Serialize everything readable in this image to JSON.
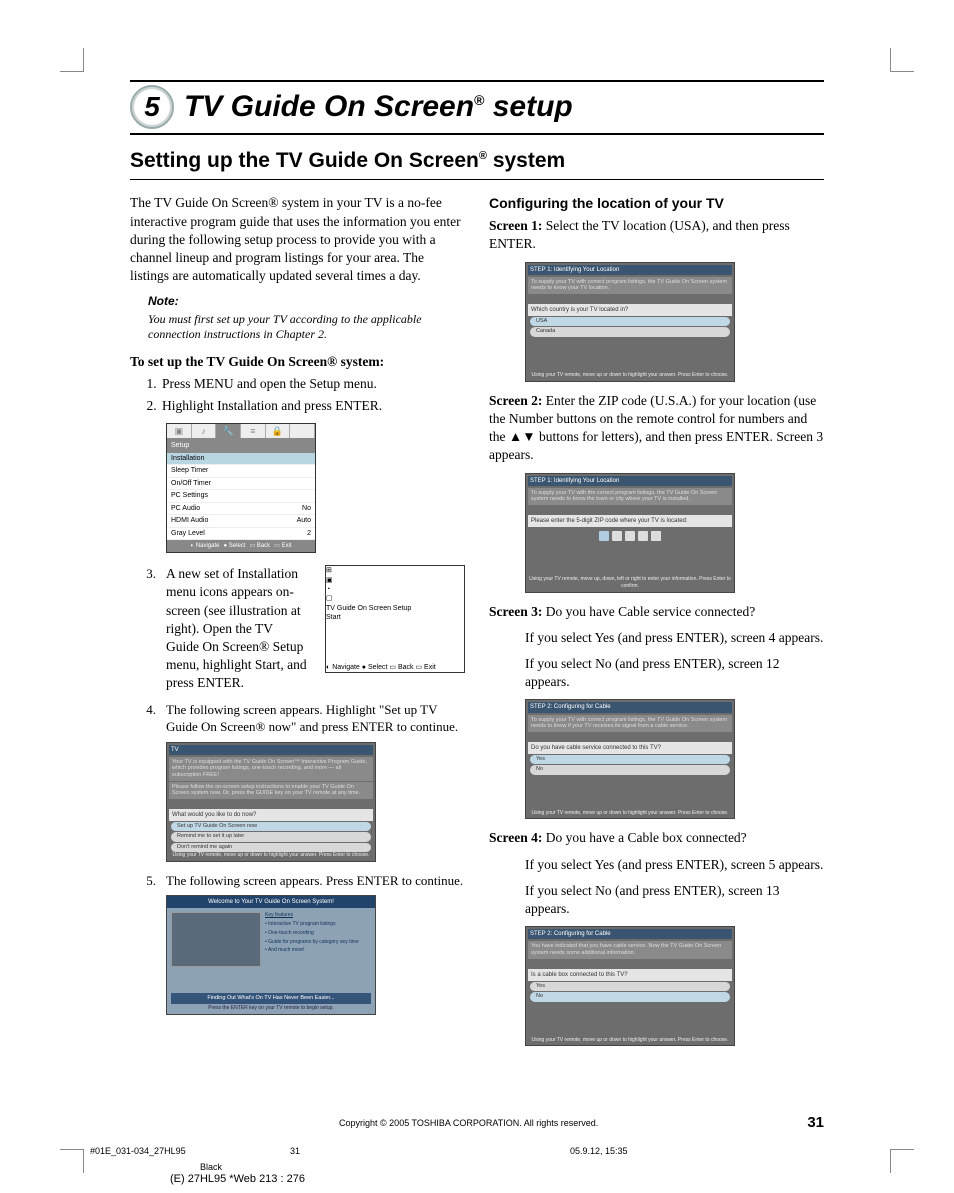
{
  "chapter": {
    "number": "5",
    "title_pre": "TV Guide On Screen",
    "title_post": " setup"
  },
  "section": {
    "title_pre": "Setting up the TV Guide On Screen",
    "title_post": " system"
  },
  "col1": {
    "intro": "The TV Guide On Screen® system in your TV is a no-fee interactive program guide that uses the information you enter during the following setup process to provide you with a channel lineup and program listings for your area. The listings are automatically updated several times a day.",
    "note_label": "Note:",
    "note_body": "You must first set up your TV according to the applicable connection instructions in Chapter 2.",
    "setup_head": "To set up the TV Guide On Screen® system:",
    "step1": "Press MENU and open the Setup menu.",
    "step2": "Highlight Installation and press ENTER.",
    "menu": {
      "title": "Setup",
      "items": [
        {
          "label": "Installation",
          "val": ""
        },
        {
          "label": "Sleep Timer",
          "val": ""
        },
        {
          "label": "On/Off Timer",
          "val": ""
        },
        {
          "label": "PC Settings",
          "val": ""
        },
        {
          "label": "PC Audio",
          "val": "No"
        },
        {
          "label": "HDMI Audio",
          "val": "Auto"
        },
        {
          "label": "Gray Level",
          "val": "2"
        }
      ],
      "foot_nav": "Navigate",
      "foot_sel": "Select",
      "foot_back": "Back",
      "foot_exit": "Exit"
    },
    "step3_num": "3.",
    "step3": "A new set of Installation menu icons appears on-screen (see illustration at right). Open the TV Guide On Screen® Setup menu, highlight Start, and press ENTER.",
    "menu2": {
      "title": "TV Guide On Screen Setup",
      "item": "Start"
    },
    "step4_num": "4.",
    "step4": "The following screen appears. Highlight \"Set up TV Guide On Screen® now\" and press ENTER to continue.",
    "tv1": {
      "info1": "Your TV is equipped with the TV Guide On Screen™ Interactive Program Guide, which provides program listings, one-touch recording, and more — all subscription FREE!",
      "info2": "Please follow the on-screen setup instructions to enable your TV Guide On Screen system now. Or, press the GUIDE key on your TV remote at any time.",
      "q": "What would you like to do now?",
      "opt1": "Set up TV Guide On Screen now",
      "opt2": "Remind me to set it up later",
      "opt3": "Don't remind me again",
      "foot": "Using your TV remote, move up or down to highlight your answer. Press Enter to choose."
    },
    "step5_num": "5.",
    "step5": "The following screen appears. Press ENTER to continue.",
    "tv2": {
      "title": "Welcome to Your TV Guide On Screen System!",
      "feat_head": "Key features",
      "feats": [
        "• Interactive TV program listings",
        "• One-touch recording",
        "• Guide for programs by category any time",
        "• And much more!"
      ],
      "bar": "Finding Out What's On TV Has Never Been Easier...",
      "bot": "Press the ENTER key on your TV remote to begin setup."
    }
  },
  "col2": {
    "head": "Configuring the location of your TV",
    "s1_label": "Screen 1:",
    "s1_text": " Select the TV location (USA), and then press ENTER.",
    "tv_s1": {
      "top": "STEP 1: Identifying Your Location",
      "info": "To supply your TV with correct program listings, the TV Guide On Screen system needs to know your TV location.",
      "q": "Which country is your TV located in?",
      "opt1": "USA",
      "opt2": "Canada",
      "foot": "Using your TV remote, move up or down to highlight your answer. Press Enter to choose."
    },
    "s2_label": "Screen 2:",
    "s2_text": " Enter the ZIP code (U.S.A.) for your location (use the Number buttons on the remote control for numbers and the ▲▼ buttons for letters), and then press ENTER. Screen 3 appears.",
    "tv_s2": {
      "top": "STEP 1: Identifying Your Location",
      "info": "To supply your TV with the correct program listings, the TV Guide On Screen system needs to know the town or city where your TV is installed.",
      "q": "Please enter the 5-digit ZIP code where your TV is located:",
      "foot": "Using your TV remote, move up, down, left or right to enter your information. Press Enter to confirm."
    },
    "s3_label": "Screen 3:",
    "s3_text": " Do you have Cable service connected?",
    "s3_yes": "If you select Yes (and press ENTER), screen 4 appears.",
    "s3_no": "If you select No (and press ENTER), screen 12 appears.",
    "tv_s3": {
      "top": "STEP 2: Configuring for Cable",
      "info": "To supply your TV with correct program listings, the TV Guide On Screen system needs to know if your TV receives its signal from a cable service.",
      "q": "Do you have cable service connected to this TV?",
      "opt1": "Yes",
      "opt2": "No",
      "foot": "Using your TV remote, move up or down to highlight your answer. Press Enter to choose."
    },
    "s4_label": "Screen 4:",
    "s4_text": " Do you have a Cable box connected?",
    "s4_yes": "If you select Yes (and press ENTER), screen 5 appears.",
    "s4_no": "If you select No (and press ENTER), screen 13 appears.",
    "tv_s4": {
      "top": "STEP 2: Configuring for Cable",
      "info": "You have indicated that you have cable service. Now the TV Guide On Screen system needs some additional information.",
      "q": "Is a cable box connected to this TV?",
      "opt1": "Yes",
      "opt2": "No",
      "foot": "Using your TV remote, move up or down to highlight your answer. Press Enter to choose."
    }
  },
  "footer": {
    "copyright": "Copyright © 2005 TOSHIBA CORPORATION. All rights reserved.",
    "page": "31",
    "meta1": "#01E_031-034_27HL95",
    "meta2": "31",
    "meta3": "05.9.12, 15:35",
    "black": "Black",
    "bot": "(E) 27HL95 *Web 213 : 276"
  }
}
